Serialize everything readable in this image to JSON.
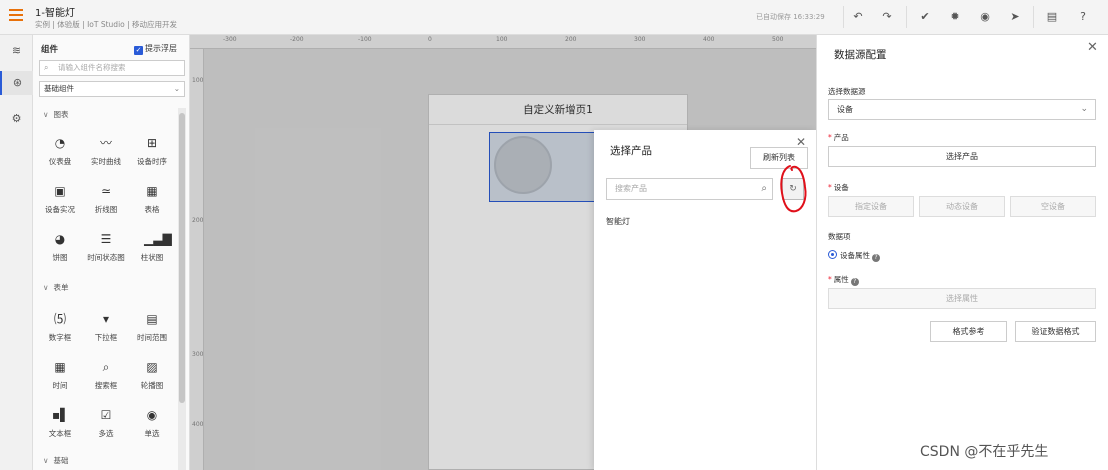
{
  "header": {
    "title": "1-智能灯",
    "subtitle": "实例 | 体验版 | IoT Studio | 移动应用开发",
    "saved_text": "已自动保存 16:33:29",
    "toolbar_icons": [
      "undo-icon",
      "redo-icon",
      "publish-icon",
      "settings-icon",
      "preview-icon",
      "send-icon",
      "document-icon",
      "help-icon"
    ]
  },
  "rail": {
    "icons": [
      "layers-icon",
      "component-icon",
      "gear-icon"
    ]
  },
  "components": {
    "title": "组件",
    "float_tip_label": "提示浮层",
    "search_placeholder": "请输入组件名称搜索",
    "category_select": "基础组件",
    "sections": [
      {
        "label": "图表",
        "items": [
          {
            "label": "仪表盘",
            "icon": "gauge-icon"
          },
          {
            "label": "实时曲线",
            "icon": "realtime-curve-icon"
          },
          {
            "label": "设备时序",
            "icon": "timeseries-icon"
          },
          {
            "label": "设备实况",
            "icon": "device-live-icon"
          },
          {
            "label": "折线图",
            "icon": "line-chart-icon"
          },
          {
            "label": "表格",
            "icon": "table-icon"
          },
          {
            "label": "饼图",
            "icon": "pie-chart-icon"
          },
          {
            "label": "时间状态图",
            "icon": "time-status-icon"
          },
          {
            "label": "柱状图",
            "icon": "bar-chart-icon"
          }
        ]
      },
      {
        "label": "表单",
        "items": [
          {
            "label": "数字框",
            "icon": "number-box-icon"
          },
          {
            "label": "下拉框",
            "icon": "dropdown-icon"
          },
          {
            "label": "时间范围",
            "icon": "time-range-icon"
          },
          {
            "label": "时间",
            "icon": "calendar-icon"
          },
          {
            "label": "搜索框",
            "icon": "search-box-icon"
          },
          {
            "label": "轮播图",
            "icon": "carousel-icon"
          },
          {
            "label": "文本框",
            "icon": "textbox-icon"
          },
          {
            "label": "多选",
            "icon": "checkbox-icon"
          },
          {
            "label": "单选",
            "icon": "radio-icon"
          }
        ]
      },
      {
        "label": "基础",
        "items": []
      }
    ]
  },
  "canvas": {
    "ruler_top": [
      "-300",
      "-200",
      "-100",
      "0",
      "100",
      "200",
      "300",
      "400",
      "500"
    ],
    "ruler_left": [
      "100",
      "200",
      "300",
      "400"
    ],
    "page_title": "自定义新增页1"
  },
  "modal": {
    "title": "选择产品",
    "refresh_label": "刷新列表",
    "search_placeholder": "搜索产品",
    "items": [
      "智能灯"
    ]
  },
  "config": {
    "title": "数据源配置",
    "source_label": "选择数据源",
    "source_value": "设备",
    "product_label": "产品",
    "product_button": "选择产品",
    "device_label": "设备",
    "device_buttons": [
      "指定设备",
      "动态设备",
      "空设备"
    ],
    "data_item_label": "数据项",
    "data_item_option": "设备属性",
    "property_label": "属性",
    "property_button": "选择属性",
    "format_button": "格式参考",
    "verify_button": "验证数据格式"
  },
  "watermark": "CSDN @不在乎先生",
  "colors": {
    "accent": "#2a5bd7",
    "brand_orange": "#e8710a",
    "required": "#e23333",
    "annotation_red": "#e0101a"
  }
}
